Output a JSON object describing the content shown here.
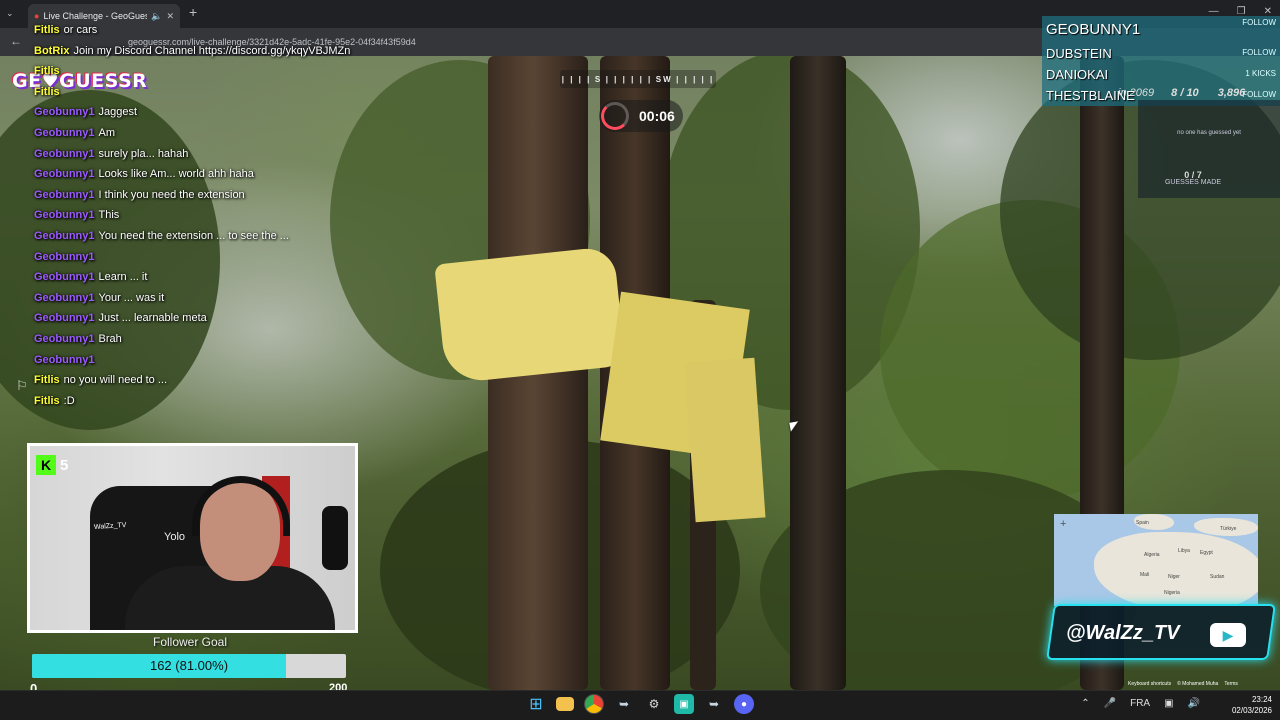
{
  "browser": {
    "tab_title": "Live Challenge - GeoGuessr",
    "url": "geoguessr.com/live-challenge/3321d42e-5adc-41fe-95e2-04f34f43f59d4",
    "icons": {
      "tab_list": "chevron-down-icon",
      "speaker": "speaker-icon",
      "close": "close-icon",
      "new_tab": "plus-icon",
      "back": "back-arrow-icon"
    }
  },
  "chat": {
    "messages": [
      {
        "user": "Fitlis",
        "text": "or cars",
        "color": "#ffff33"
      },
      {
        "user": "BotRix",
        "text": "Join my Discord Channel https://discord.gg/ykqyVBJMZn",
        "color": "#ffff33"
      },
      {
        "user": "Fitlis",
        "text": "",
        "color": "#ffff33"
      },
      {
        "user": "Fitlis",
        "text": "",
        "color": "#ffff33"
      },
      {
        "user": "Geobunny1",
        "text": "Jaggest",
        "color": "#9b59ff"
      },
      {
        "user": "Geobunny1",
        "text": "Am",
        "color": "#9b59ff"
      },
      {
        "user": "Geobunny1",
        "text": "surely pla... hahah",
        "color": "#9b59ff"
      },
      {
        "user": "Geobunny1",
        "text": "Looks like Am... world ahh haha",
        "color": "#9b59ff"
      },
      {
        "user": "Geobunny1",
        "text": "I think you need the extension",
        "color": "#9b59ff"
      },
      {
        "user": "Geobunny1",
        "text": "This",
        "color": "#9b59ff"
      },
      {
        "user": "Geobunny1",
        "text": "You need the extension ... to see the ...",
        "color": "#9b59ff"
      },
      {
        "user": "Geobunny1",
        "text": "",
        "color": "#9b59ff"
      },
      {
        "user": "Geobunny1",
        "text": "Learn ... it",
        "color": "#9b59ff"
      },
      {
        "user": "Geobunny1",
        "text": "Your ... was it",
        "color": "#9b59ff"
      },
      {
        "user": "Geobunny1",
        "text": "Just ... learnable meta",
        "color": "#9b59ff"
      },
      {
        "user": "Geobunny1",
        "text": "Brah",
        "color": "#9b59ff"
      },
      {
        "user": "Geobunny1",
        "text": "",
        "color": "#9b59ff"
      },
      {
        "user": "Fitlis",
        "text": "no you will need to ...",
        "color": "#ffff33"
      },
      {
        "user": "Fitlis",
        "text": ":D",
        "color": "#ffff33"
      }
    ]
  },
  "game": {
    "logo": "GE♥GUESSR",
    "compass": [
      "S",
      "SW"
    ],
    "timer": "00:06",
    "colors": {
      "timer_ring": "#ff4d5f",
      "leaderboard_bg": "#1e6e7d"
    }
  },
  "leaderboard": {
    "rows": [
      {
        "name": "GEOBUNNY1",
        "follow": "FOLLOW"
      },
      {
        "name": "DUBSTEIN",
        "follow": "FOLLOW"
      },
      {
        "name": "DANIOKAI",
        "follow": "1 KICKS"
      },
      {
        "name": "THESTBLAINE",
        "follow": "FOLLOW"
      }
    ],
    "round_label": "in 2069",
    "round": "8 / 10",
    "score": "3,896"
  },
  "guesses": {
    "none_text": "no one has guessed yet",
    "count": "0 / 7",
    "label": "GUESSES MADE"
  },
  "minimap": {
    "labels": [
      "Spain",
      "Türkiye",
      "Algeria",
      "Libya",
      "Egypt",
      "Mali",
      "Niger",
      "Sudan",
      "Nigeria"
    ],
    "footer": [
      "Keyboard shortcuts",
      "© Mohamed Muha",
      "Terms"
    ]
  },
  "banner": {
    "handle": "@WalZz_TV",
    "icon": "youtube-icon"
  },
  "webcam": {
    "chair_label": "Yolo",
    "shirt_badge": "WalZz_TV",
    "kick_count": "5"
  },
  "follower_goal": {
    "title": "Follower Goal",
    "progress_text": "162 (81.00%)",
    "current": 162,
    "progress": 0.81,
    "min": "0",
    "max": "200",
    "color": "#33dfe1"
  },
  "taskbar": {
    "apps": [
      "windows-start-icon",
      "file-explorer-icon",
      "chrome-icon",
      "steam-icon",
      "settings-icon",
      "app-icon",
      "steam-icon",
      "discord-icon"
    ],
    "language": "FRA",
    "time": "23:24",
    "date": "02/03/2026"
  }
}
